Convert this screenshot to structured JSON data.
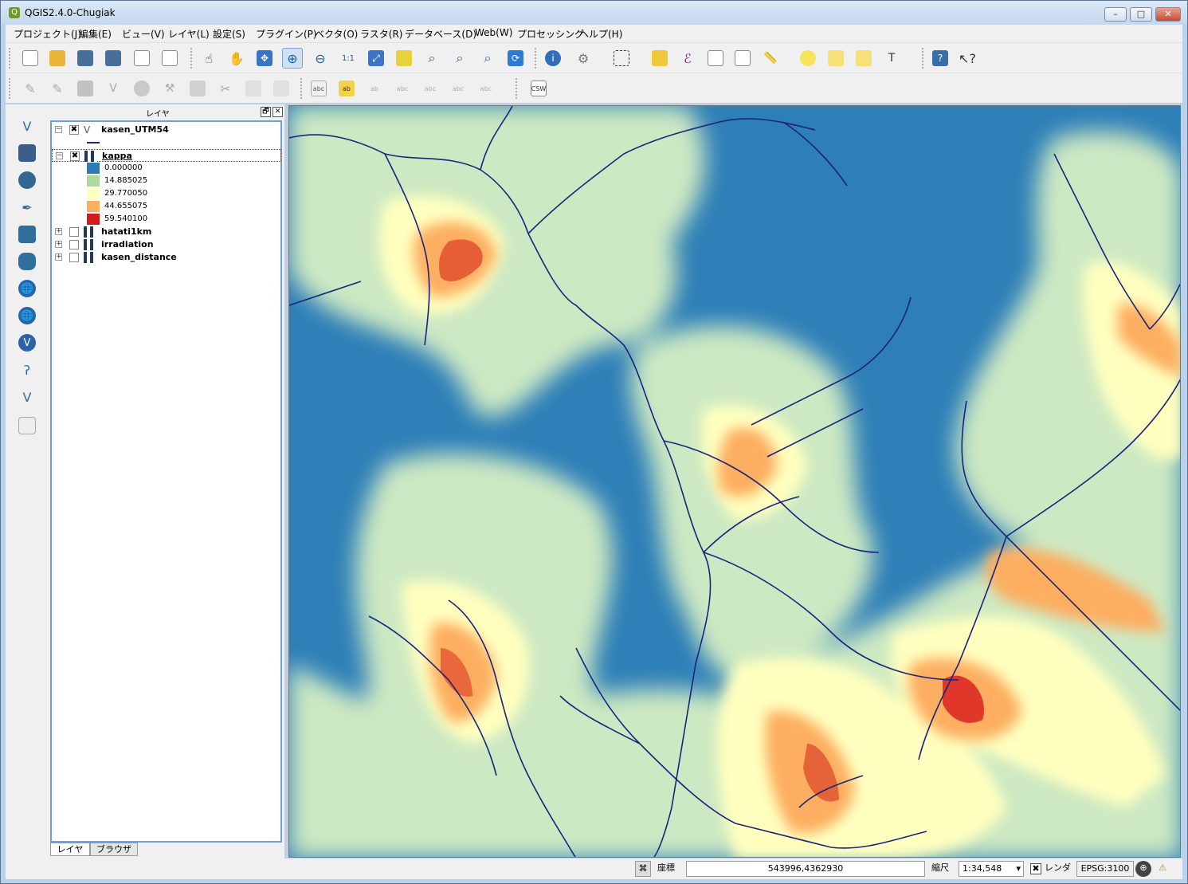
{
  "window": {
    "title": "QGIS2.4.0-Chugiak",
    "minimize": "–",
    "restore": "□",
    "close": "✕"
  },
  "menu": [
    "プロジェクト(J)",
    "編集(E)",
    "ビュー(V)",
    "レイヤ(L)",
    "設定(S)",
    "プラグイン(P)",
    "ベクタ(O)",
    "ラスタ(R)",
    "データベース(D)",
    "Web(W)",
    "プロセッシング",
    "ヘルプ(H)"
  ],
  "toolbar2": {
    "csw_label": "CSW",
    "abc": "abc",
    "ab": "ab"
  },
  "layers_panel": {
    "title": "レイヤ",
    "restore_icon": "🗗",
    "close_icon": "✕",
    "expanded": "−",
    "collapsed": "+",
    "check": "✖",
    "layers": [
      {
        "name": "kasen_UTM54",
        "checked": true
      },
      {
        "name": "kappa",
        "checked": true
      },
      {
        "name": "hatati1km",
        "checked": false
      },
      {
        "name": "irradiation",
        "checked": false
      },
      {
        "name": "kasen_distance",
        "checked": false
      }
    ],
    "legend": [
      {
        "label": "0.000000",
        "color": "#2c7bb6"
      },
      {
        "label": "14.885025",
        "color": "#abd9e9"
      },
      {
        "label": "29.770050",
        "color": "#ffffbf"
      },
      {
        "label": "44.655075",
        "color": "#fdae61"
      },
      {
        "label": "59.540100",
        "color": "#d7191c"
      }
    ],
    "tabs": [
      "レイヤ",
      "ブラウザ"
    ]
  },
  "statusbar": {
    "coord_label": "座標",
    "coord_value": "543996,4362930",
    "scale_label": "縮尺",
    "scale_value": "1:34,548",
    "render_label": "レンダ",
    "render_check": "✖",
    "crs": "EPSG:3100"
  },
  "colors": {
    "water": "#2e7fb8",
    "river": "#1a237e",
    "low": "#c9e8c0",
    "mid": "#ffffbf",
    "high": "#fdae61",
    "peak": "#d7191c"
  }
}
